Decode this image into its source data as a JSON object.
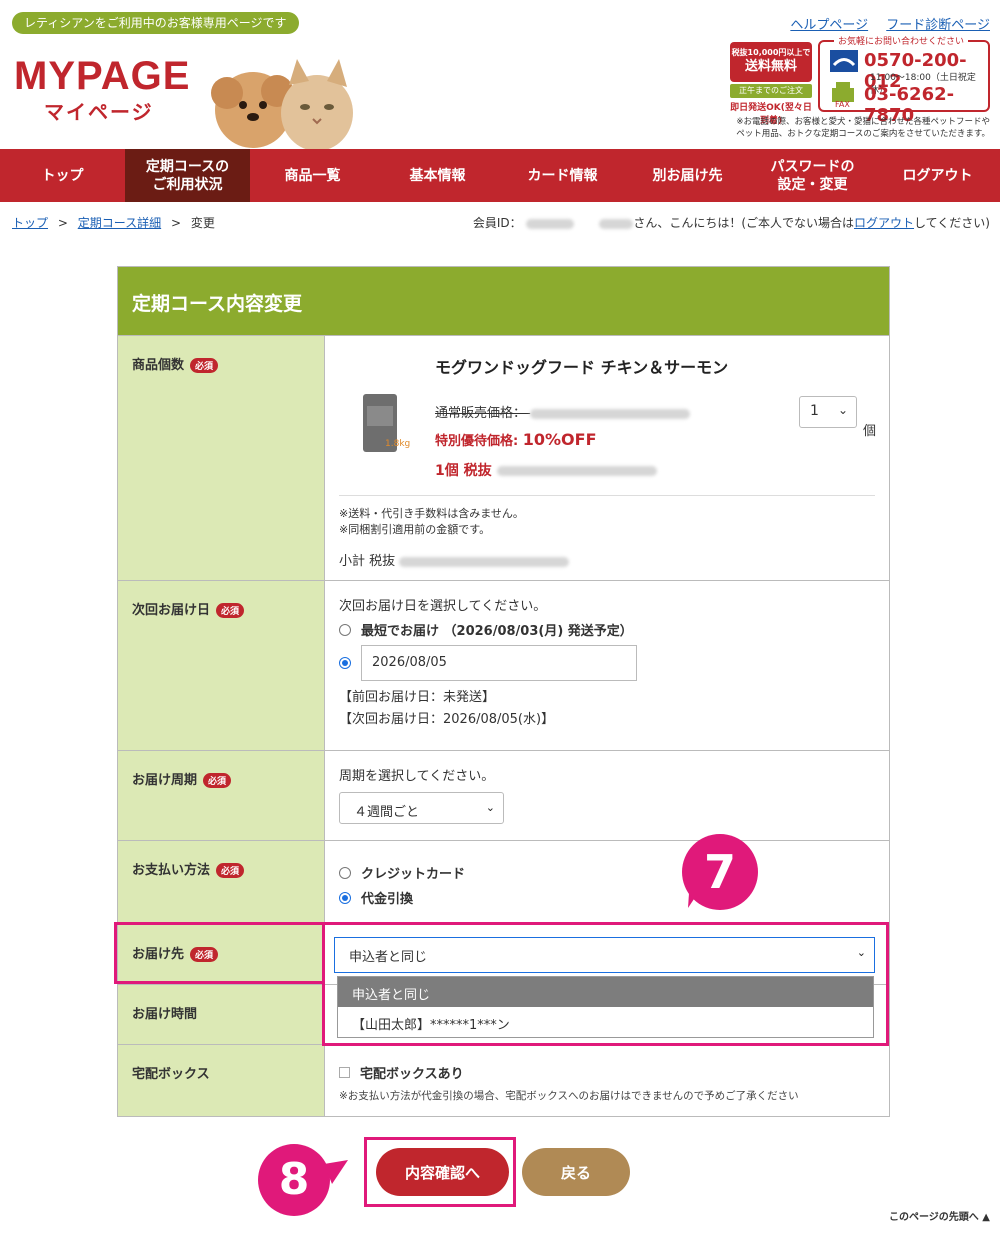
{
  "header": {
    "pill": "レティシアンをご利用中のお客様専用ページです",
    "help_link": "ヘルプページ",
    "diag_link": "フード診断ページ",
    "logo_en": "MYPAGE",
    "logo_ja": "マイページ",
    "free_ship_line1": "税抜10,000円以上で",
    "free_ship_line2": "送料無料",
    "free_ship_noon": "正午までのご注文",
    "free_ship_same": "即日発送OK(翌々日到着)",
    "contact_caption": "お気軽にお問い合わせください",
    "tel": "0570-200-012",
    "hours": "11:00〜18:00（土日祝定休）",
    "fax_label": "FAX",
    "fax": "03-6262-7870",
    "notice": "※お電話の際、お客様と愛犬・愛猫に合わせた各種ペットフードやペット用品、おトクな定期コースのご案内をさせていただきます。"
  },
  "nav": [
    {
      "label": "トップ",
      "active": false
    },
    {
      "label": "定期コースの\nご利用状況",
      "active": true
    },
    {
      "label": "商品一覧",
      "active": false
    },
    {
      "label": "基本情報",
      "active": false
    },
    {
      "label": "カード情報",
      "active": false
    },
    {
      "label": "別お届け先",
      "active": false
    },
    {
      "label": "パスワードの\n設定・変更",
      "active": false
    },
    {
      "label": "ログアウト",
      "active": false
    }
  ],
  "breadcrumb": {
    "top": "トップ",
    "sep": ">",
    "detail": "定期コース詳細",
    "current": "変更"
  },
  "member": {
    "prefix": "会員ID：",
    "greeting": "さん、こんにちは！(ご本人でない場合は",
    "logout": "ログアウト",
    "suffix": "してください)"
  },
  "form": {
    "title": "定期コース内容変更",
    "required": "必須",
    "rows": {
      "quantity": "商品個数",
      "next_date": "次回お届け日",
      "cycle": "お届け周期",
      "payment": "お支払い方法",
      "destination": "お届け先",
      "time": "お届け時間",
      "box": "宅配ボックス"
    },
    "product": {
      "name": "モグワンドッグフード チキン＆サーモン",
      "regular_label": "通常販売価格：",
      "special_label": "特別優待価格: ",
      "special_pct": "10%OFF",
      "tax_label": "1個 税抜",
      "weight": "1.8kg",
      "qty": "1",
      "unit": "個",
      "note1": "※送料・代引き手数料は含みません。",
      "note2": "※同梱割引適用前の金額です。",
      "subtotal_label": "小計 税抜"
    },
    "next_date": {
      "prompt": "次回お届け日を選択してください。",
      "option_earliest": "最短でお届け （2026/08/03(月) 発送予定）",
      "date_value": "2026/08/05",
      "prev": "【前回お届け日：未発送】",
      "next": "【次回お届け日：2026/08/05(水)】"
    },
    "cycle": {
      "prompt": "周期を選択してください。",
      "value": "４週間ごと"
    },
    "payment": {
      "credit": "クレジットカード",
      "cod": "代金引換"
    },
    "destination": {
      "value": "申込者と同じ",
      "options": [
        "申込者と同じ",
        "【山田太郎】******1***ン"
      ]
    },
    "box": {
      "label": "宅配ボックスあり",
      "note": "※お支払い方法が代金引換の場合、宅配ボックスへのお届けはできませんので予めご了承ください"
    }
  },
  "markers": {
    "seven": "7",
    "eight": "8"
  },
  "buttons": {
    "confirm": "内容確認へ",
    "back": "戻る",
    "page_top": "このページの先頭へ"
  },
  "colors": {
    "brand_red": "#c0262d",
    "green": "#8cab2e",
    "label_bg": "#dce9b5",
    "highlight": "#e0197a",
    "back_btn": "#b08a55"
  }
}
